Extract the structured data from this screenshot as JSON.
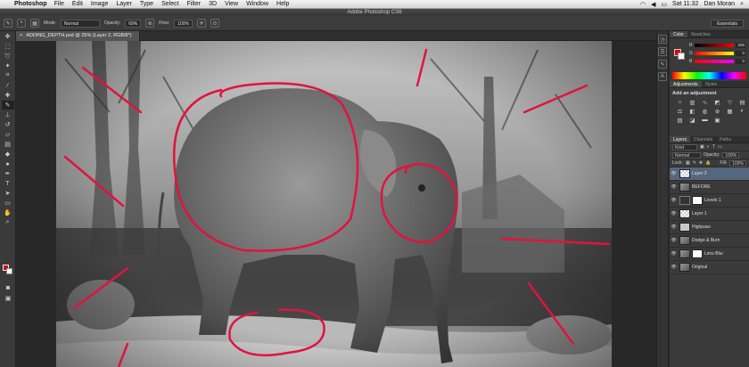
{
  "menubar": {
    "app_name": "Photoshop",
    "items": [
      "File",
      "Edit",
      "Image",
      "Layer",
      "Type",
      "Select",
      "Filter",
      "3D",
      "View",
      "Window",
      "Help"
    ],
    "clock": "Sat 11:32",
    "user": "Dan Moran"
  },
  "titlebar": {
    "title": "Adobe Photoshop CS6"
  },
  "options": {
    "mode_label": "Mode:",
    "mode_value": "Normal",
    "opacity_label": "Opacity:",
    "opacity_value": "69%",
    "flow_label": "Flow:",
    "flow_value": "100%",
    "workspace": "Essentials"
  },
  "document": {
    "tab_title": "ADDING_DEPTH.psd @ 25% (Layer 2, RGB/8*)"
  },
  "panels": {
    "color_tabs": [
      "Color",
      "Swatches"
    ],
    "color_values": {
      "r": "255",
      "g": "0",
      "b": "0"
    },
    "adjust_tabs": [
      "Adjustments",
      "Styles"
    ],
    "adjust_title": "Add an adjustment",
    "layers_tabs": [
      "Layers",
      "Channels",
      "Paths"
    ],
    "kind_label": "Kind",
    "blend_mode": "Normal",
    "opacity_label": "Opacity:",
    "opacity_value": "100%",
    "lock_label": "Lock:",
    "fill_label": "Fill:",
    "fill_value": "100%",
    "layers": [
      {
        "name": "Layer 2",
        "thumb": "check",
        "mask": false,
        "selected": true
      },
      {
        "name": "BEFORE",
        "thumb": "gray",
        "mask": false,
        "selected": false
      },
      {
        "name": "Levels 1",
        "thumb": "adj",
        "mask": true,
        "selected": false
      },
      {
        "name": "Layer 1",
        "thumb": "check",
        "mask": false,
        "selected": false
      },
      {
        "name": "Highpass",
        "thumb": "red",
        "mask": false,
        "selected": false
      },
      {
        "name": "Dodge & Burn",
        "thumb": "gray",
        "mask": false,
        "selected": false
      },
      {
        "name": "Lens Blur",
        "thumb": "gray",
        "mask": true,
        "selected": false
      },
      {
        "name": "Original",
        "thumb": "gray",
        "mask": false,
        "selected": false
      }
    ]
  },
  "colors": {
    "accent_red": "#e0143c",
    "panel": "#3a3a3a",
    "selected_layer": "#55677f"
  }
}
